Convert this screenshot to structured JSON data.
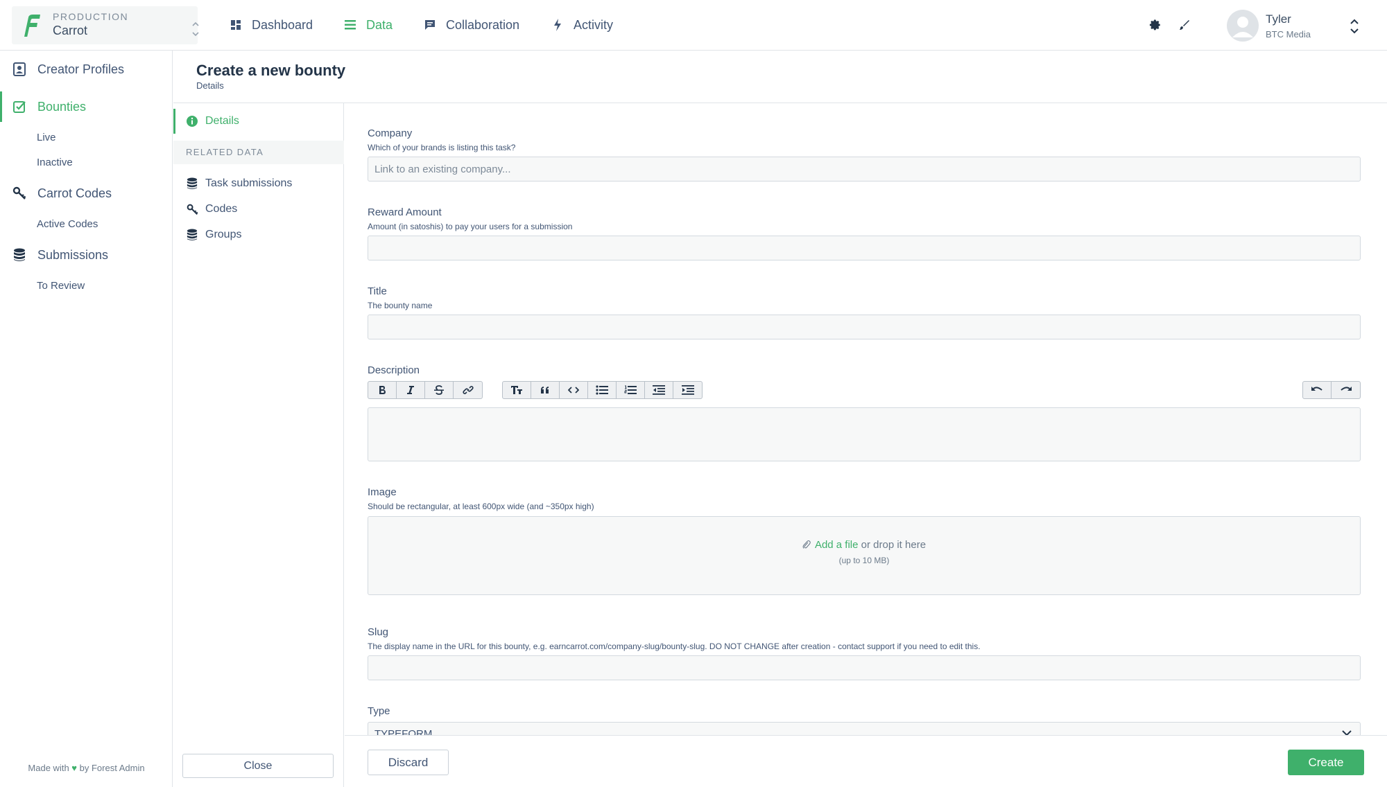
{
  "env": {
    "label": "PRODUCTION",
    "name": "Carrot"
  },
  "nav": [
    {
      "label": "Dashboard",
      "icon": "dashboard-icon"
    },
    {
      "label": "Data",
      "icon": "list-icon",
      "active": true
    },
    {
      "label": "Collaboration",
      "icon": "chat-icon"
    },
    {
      "label": "Activity",
      "icon": "bolt-icon"
    }
  ],
  "user": {
    "name": "Tyler",
    "org": "BTC Media"
  },
  "sidebar": {
    "items": [
      {
        "label": "Creator Profiles",
        "icon": "profile-icon"
      },
      {
        "label": "Bounties",
        "icon": "checkbox-icon",
        "active": true
      },
      {
        "label": "Carrot Codes",
        "icon": "key-icon"
      },
      {
        "label": "Submissions",
        "icon": "database-icon"
      }
    ],
    "subs": {
      "live": "Live",
      "inactive": "Inactive",
      "active_codes": "Active Codes",
      "to_review": "To Review"
    },
    "footer": {
      "prefix": "Made with",
      "heart": "♥",
      "suffix": "by Forest Admin"
    }
  },
  "page": {
    "title": "Create a new bounty",
    "subtitle": "Details"
  },
  "secondary": {
    "details": "Details",
    "related_header": "RELATED DATA",
    "links": [
      "Task submissions",
      "Codes",
      "Groups"
    ],
    "close": "Close"
  },
  "form": {
    "company": {
      "label": "Company",
      "help": "Which of your brands is listing this task?",
      "placeholder": "Link to an existing company...",
      "value": ""
    },
    "reward": {
      "label": "Reward Amount",
      "help": "Amount (in satoshis) to pay your users for a submission",
      "value": ""
    },
    "title": {
      "label": "Title",
      "help": "The bounty name",
      "value": ""
    },
    "description": {
      "label": "Description"
    },
    "image": {
      "label": "Image",
      "help": "Should be rectangular, at least 600px wide (and ~350px high)",
      "add": "Add a file",
      "drop": " or drop it here",
      "limit": "(up to 10 MB)"
    },
    "slug": {
      "label": "Slug",
      "help": "The display name in the URL for this bounty, e.g. earncarrot.com/company-slug/bounty-slug. DO NOT CHANGE after creation - contact support if you need to edit this.",
      "value": ""
    },
    "type": {
      "label": "Type",
      "value": "TYPEFORM"
    }
  },
  "footer": {
    "discard": "Discard",
    "create": "Create"
  },
  "colors": {
    "accent": "#3fb06b",
    "text": "#415574",
    "border": "#e0e4e8"
  }
}
